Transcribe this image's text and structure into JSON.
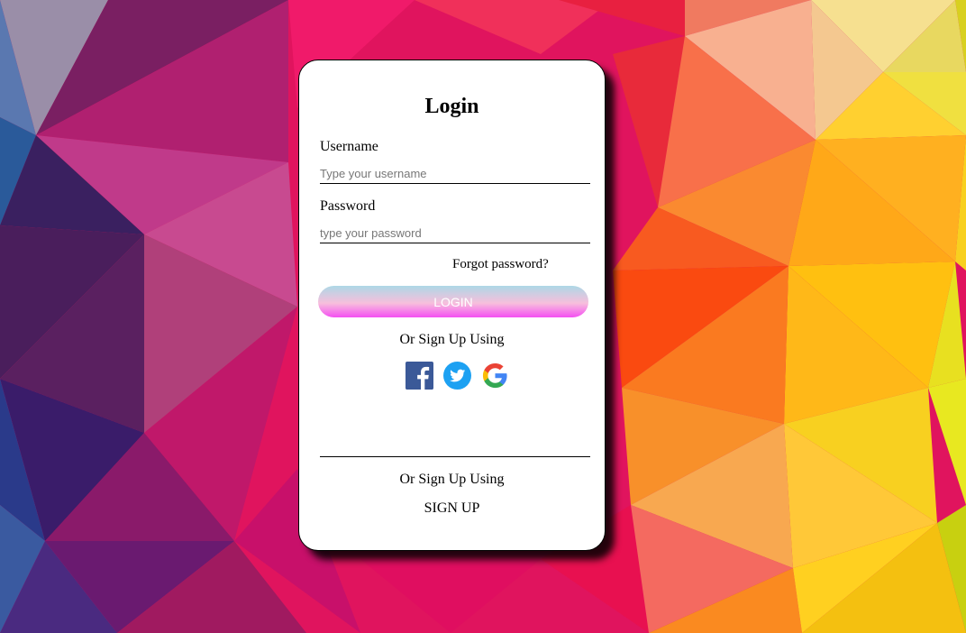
{
  "login": {
    "title": "Login",
    "username_label": "Username",
    "username_placeholder": "Type your username",
    "password_label": "Password",
    "password_placeholder": "type your password",
    "forgot_link": "Forgot password?",
    "login_button": "LOGIN",
    "social_heading": "Or Sign Up Using",
    "social_icons": [
      "facebook-icon",
      "twitter-icon",
      "google-icon"
    ],
    "footer_heading": "Or Sign Up Using",
    "signup_link": "SIGN UP"
  },
  "colors": {
    "button_gradient_top": "#add8e6",
    "button_gradient_bottom": "#f44ff2",
    "facebook": "#3b5998",
    "twitter": "#1da1f2"
  }
}
